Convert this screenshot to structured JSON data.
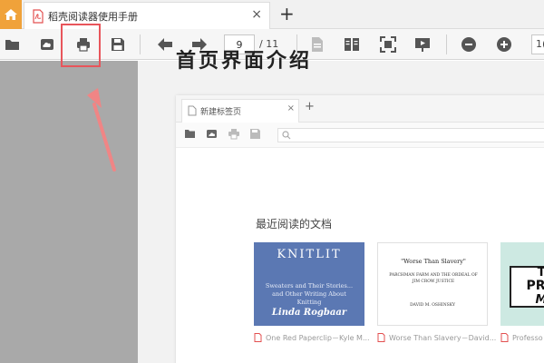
{
  "app": {
    "tab_title": "稻壳阅读器使用手册",
    "tab_close": "×",
    "new_tab": "+"
  },
  "toolbar": {
    "current_page": "9",
    "total_pages": "/ 11",
    "zoom_value": "1("
  },
  "document": {
    "heading": "首页界面介绍"
  },
  "embedded_app": {
    "tab_title": "新建标签页",
    "tab_close": "×",
    "new_tab": "+",
    "recent_label": "最近阅读的文档",
    "books": [
      {
        "cover_title": "KNITLIT",
        "cover_subtitle": "Sweaters and Their Stories... and Other Writing About Knitting",
        "cover_author": "Linda Rogbaar",
        "caption": "One Red Paperclip－Kyle M..."
      },
      {
        "cover_title": "\"Worse Than Slavery\"",
        "cover_subtitle": "PARCHMAN FARM AND THE ORDEAL OF JIM CROW JUSTICE",
        "cover_author": "DAVID M. OSHINSKY",
        "caption": "Worse Than Slavery－David..."
      },
      {
        "cover_line1": "T",
        "cover_line2": "PRO",
        "cover_line3": "M",
        "caption": "Professo"
      }
    ]
  },
  "icons": {
    "home": "home-icon",
    "pdf": "pdf-icon",
    "open": "folder-open-icon",
    "cloud": "cloud-icon",
    "print": "printer-icon",
    "save": "save-icon",
    "back": "arrow-left-icon",
    "forward": "arrow-right-icon",
    "single_page": "single-page-icon",
    "double_page": "double-page-icon",
    "fit": "fit-screen-icon",
    "present": "presentation-icon",
    "zoom_out": "zoom-out-icon",
    "zoom_in": "zoom-in-icon"
  },
  "colors": {
    "home_button": "#f0a23a",
    "highlight": "#e8555b",
    "left_panel": "#a9a9a9",
    "book1_cover": "#5b78b3",
    "book3_cover": "#cde9e2"
  }
}
